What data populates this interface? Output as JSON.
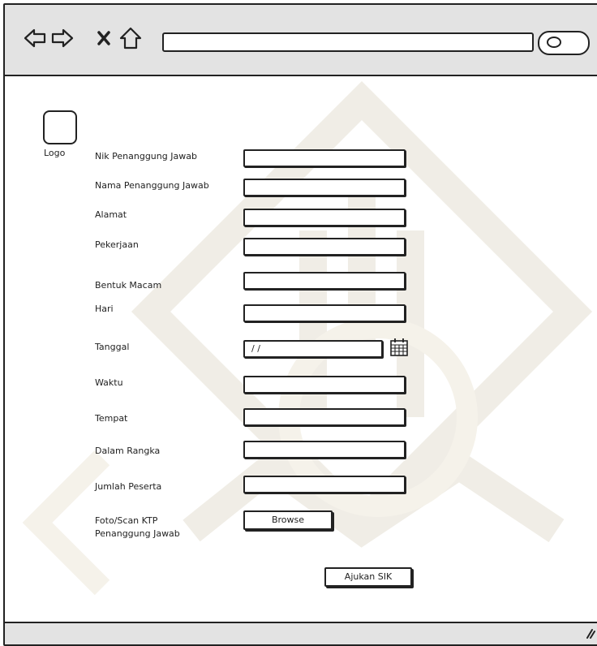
{
  "browser": {
    "back_icon": "back-arrow-icon",
    "forward_icon": "forward-arrow-icon",
    "stop_icon": "close-icon",
    "home_icon": "home-icon",
    "search_icon": "search-icon"
  },
  "header": {
    "logo_label": "Logo"
  },
  "form": {
    "nik_label": "Nik Penanggung Jawab",
    "nama_label": "Nama Penanggung Jawab",
    "alamat_label": "Alamat",
    "pekerjaan_label": "Pekerjaan",
    "bentuk_label": "Bentuk Macam",
    "hari_label": "Hari",
    "tanggal_label": "Tanggal",
    "tanggal_value": "/ /",
    "waktu_label": "Waktu",
    "tempat_label": "Tempat",
    "rangka_label": "Dalam Rangka",
    "jumlah_label": "Jumlah Peserta",
    "foto_label_line1": "Foto/Scan KTP",
    "foto_label_line2": "Penanggung Jawab",
    "browse_label": "Browse",
    "submit_label": "Ajukan SIK"
  }
}
